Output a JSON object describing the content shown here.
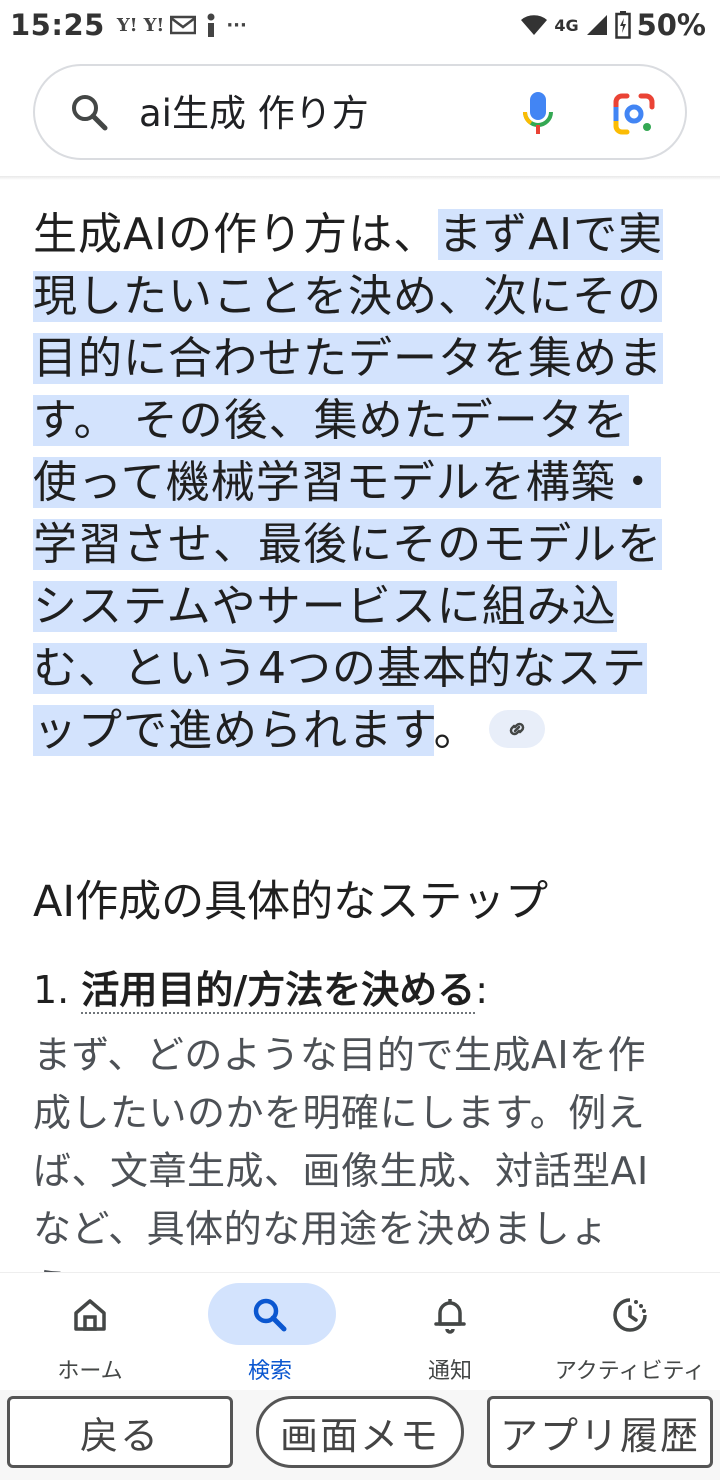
{
  "status_bar": {
    "time": "15:25",
    "notification_icons": [
      "Y!",
      "Y!",
      "mail-icon",
      "info-icon",
      "···"
    ],
    "network": "4G",
    "battery": "50%"
  },
  "search": {
    "query": "ai生成 作り方"
  },
  "answer": {
    "intro": "生成AIの作り方は、",
    "highlighted": "まずAIで実現したいことを決め、次にその目的に合わせたデータを集めます。 その後、集めたデータを使って機械学習モデルを構築・学習させ、最後にそのモデルをシステムやサービスに組み込む、という4つの基本的なステップで進められます",
    "end": "。"
  },
  "section_heading": "AI作成の具体的なステップ",
  "steps": [
    {
      "number": "1.",
      "title": "活用目的/方法を決める",
      "colon": ":",
      "body": "まず、どのような目的で生成AIを作成したいのかを明確にします。例えば、文章生成、画像生成、対話型AIなど、具体的な用途を決めましょう。"
    }
  ],
  "bottom_nav": {
    "items": [
      {
        "label": "ホーム",
        "icon": "home-icon",
        "active": false
      },
      {
        "label": "検索",
        "icon": "search-icon",
        "active": true
      },
      {
        "label": "通知",
        "icon": "bell-icon",
        "active": false
      },
      {
        "label": "アクティビティ",
        "icon": "activity-icon",
        "active": false
      }
    ]
  },
  "system_buttons": {
    "back": "戻る",
    "memo": "画面メモ",
    "recent": "アプリ履歴"
  },
  "colors": {
    "highlight": "#d3e3fd",
    "active_nav": "#0b57d0"
  }
}
